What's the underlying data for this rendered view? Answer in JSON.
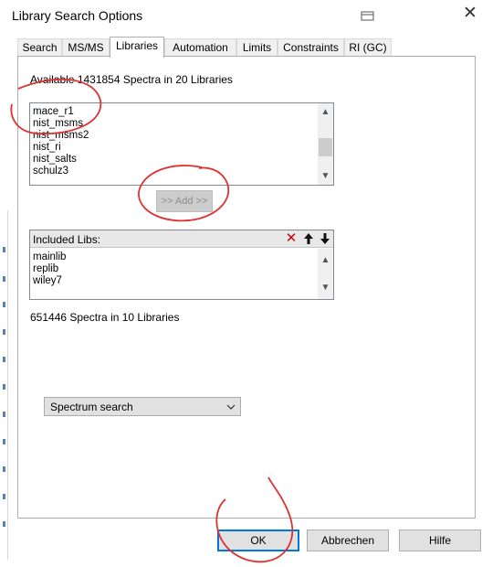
{
  "window": {
    "title": "Library Search Options",
    "close_glyph": "✕"
  },
  "tabs": [
    {
      "label": "Search",
      "active": false
    },
    {
      "label": "MS/MS",
      "active": false
    },
    {
      "label": "Libraries",
      "active": true
    },
    {
      "label": "Automation",
      "active": false
    },
    {
      "label": "Limits",
      "active": false
    },
    {
      "label": "Constraints",
      "active": false
    },
    {
      "label": "RI (GC)",
      "active": false
    }
  ],
  "libraries": {
    "available_text": "Available 1431854 Spectra in 20 Libraries",
    "available_list": [
      "mace_r1",
      "nist_msms",
      "nist_msms2",
      "nist_ri",
      "nist_salts",
      "schulz3"
    ],
    "add_label": ">> Add >>",
    "included_title": "Included Libs:",
    "included_list": [
      "mainlib",
      "replib",
      "wiley7"
    ],
    "included_summary": "651446 Spectra in 10 Libraries",
    "search_type": "Spectrum search"
  },
  "icons": {
    "remove": "✕",
    "move_up": "🡡",
    "move_down": "🡣"
  },
  "colors": {
    "remove_icon": "#cc0000",
    "default_button_border": "#0078d7",
    "annotation_pen": "#e03030"
  },
  "footer": {
    "ok": "OK",
    "cancel": "Abbrechen",
    "help": "Hilfe"
  }
}
